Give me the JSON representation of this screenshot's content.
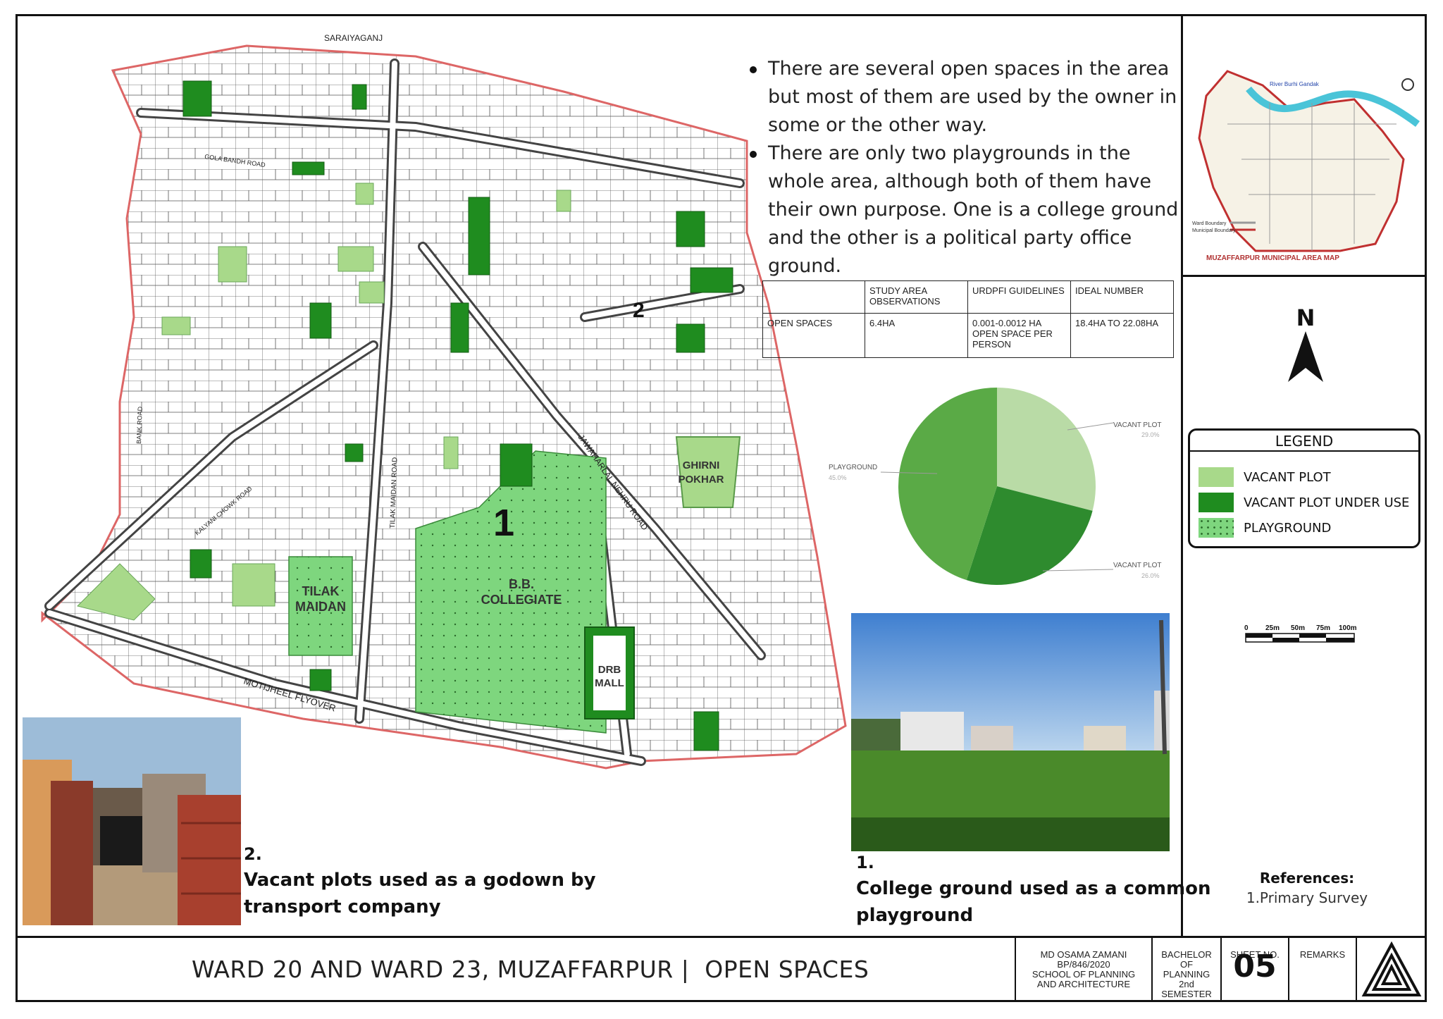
{
  "bullets": [
    "There are several open spaces in the area but most of them are used by the owner in some or the other way.",
    "There are only two playgrounds in the whole area, although both of them have their own purpose. One is a college ground and the other is a political party office ground."
  ],
  "table": {
    "headers": [
      "",
      "STUDY AREA OBSERVATIONS",
      "URDPFI GUIDELINES",
      "IDEAL NUMBER"
    ],
    "rows": [
      [
        "OPEN SPACES",
        "6.4HA",
        "0.001-0.0012 HA OPEN SPACE PER PERSON",
        "18.4HA TO 22.08HA"
      ]
    ]
  },
  "chart_data": {
    "type": "pie",
    "slices": [
      {
        "label": "VACANT PLOT",
        "value": 29.0,
        "color": "#b9dba6"
      },
      {
        "label": "VACANT PLOT",
        "value": 26.0,
        "color": "#2e8b2e"
      },
      {
        "label": "PLAYGROUND",
        "value": 45.0,
        "color": "#5aaa46"
      }
    ],
    "value_labels": [
      "29.0%",
      "26.0%",
      "45.0%"
    ]
  },
  "map": {
    "road_labels": [
      "SARAIYAGANJ",
      "GOLA BANDH ROAD",
      "MOTIJHEEL FLYOVER",
      "JAWAHARLAL NEHRU ROAD",
      "TILAK MAIDAN ROAD",
      "BANK ROAD",
      "KALYANI CHOWK ROAD"
    ],
    "place_labels": {
      "tilak_line1": "TILAK",
      "tilak_line2": "MAIDAN",
      "bb_line1": "B.B.",
      "bb_line2": "COLLEGIATE",
      "ghirni_line1": "GHIRNI",
      "ghirni_line2": "POKHAR",
      "drb_line1": "DRB",
      "drb_line2": "MALL"
    },
    "markers": [
      "1",
      "2"
    ]
  },
  "photos": {
    "photo2": {
      "number": "2.",
      "caption_line1": "Vacant plots used as a godown by",
      "caption_line2": "transport company"
    },
    "photo1": {
      "number": "1.",
      "caption_line1": "College ground used as a common",
      "caption_line2": "playground"
    }
  },
  "inset": {
    "title": "MUZAFFARPUR MUNICIPAL AREA MAP",
    "river": "River Burhi Gandak",
    "legend_ward": "Ward Boundary",
    "legend_municipal": "Municipal Boundary"
  },
  "north_label": "N",
  "legend": {
    "title": "LEGEND",
    "items": [
      {
        "label": "VACANT PLOT",
        "color": "#a8d98a"
      },
      {
        "label": "VACANT PLOT UNDER USE",
        "color": "#1f8c1f"
      },
      {
        "label": "PLAYGROUND",
        "color": "#7ed67e"
      }
    ]
  },
  "scale_bar": {
    "labels": [
      "0",
      "25m",
      "50m",
      "75m",
      "100m"
    ]
  },
  "references": {
    "title": "References:",
    "items": [
      "1.Primary Survey"
    ]
  },
  "title_block": {
    "title": "WARD 20 AND WARD 23, MUZAFFARPUR |  OPEN SPACES",
    "author_lines": [
      "MD OSAMA ZAMANI",
      "BP/846/2020",
      "SCHOOL OF PLANNING",
      "AND ARCHITECTURE"
    ],
    "course_lines": [
      "BACHELOR",
      "OF",
      "PLANNING",
      "2nd SEMESTER"
    ],
    "sheet_label": "SHEET NO.",
    "sheet_number": "05",
    "remarks_label": "REMARKS"
  }
}
